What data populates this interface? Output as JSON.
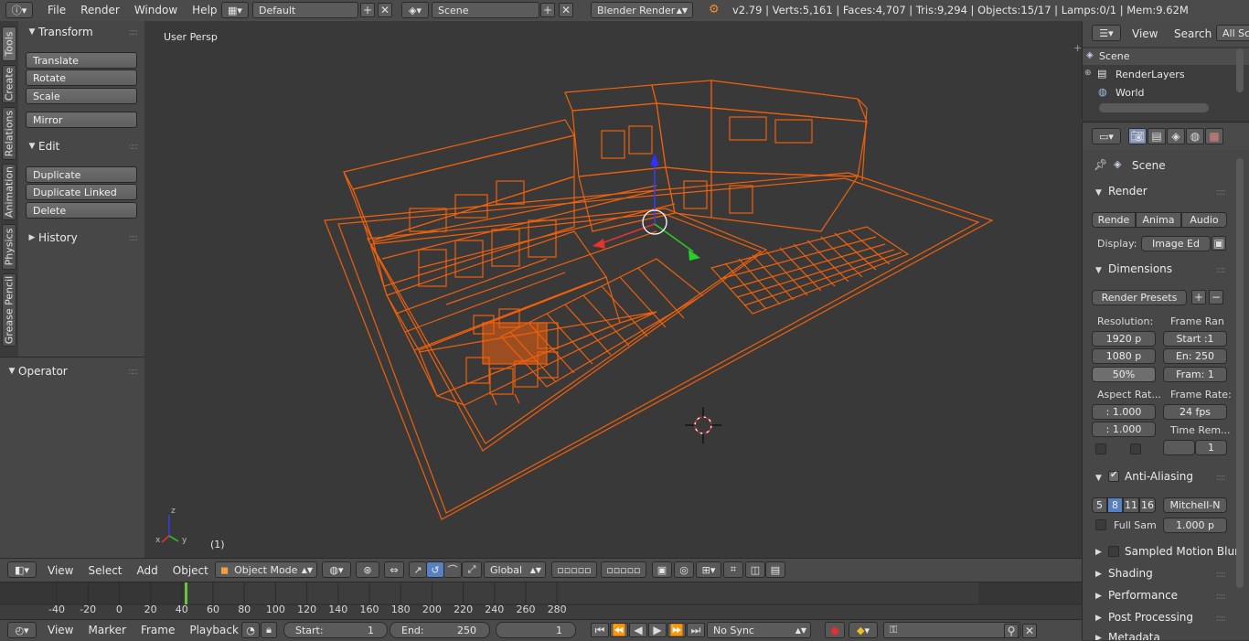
{
  "topbar": {
    "menus": [
      "File",
      "Render",
      "Window",
      "Help"
    ],
    "layout": "Default",
    "scene": "Scene",
    "engine": "Blender Render",
    "stats": "v2.79 | Verts:5,161 | Faces:4,707 | Tris:9,294 | Objects:15/17 | Lamps:0/1 | Mem:9.62M"
  },
  "tabs": [
    "Tools",
    "Create",
    "Relations",
    "Animation",
    "Physics",
    "Grease Pencil"
  ],
  "toolshelf": {
    "transform": {
      "title": "Transform",
      "buttons": [
        "Translate",
        "Rotate",
        "Scale",
        "Mirror"
      ]
    },
    "edit": {
      "title": "Edit",
      "buttons": [
        "Duplicate",
        "Duplicate Linked",
        "Delete"
      ]
    },
    "history": {
      "title": "History"
    },
    "operator": {
      "title": "Operator"
    }
  },
  "viewport": {
    "view_name": "User Persp",
    "frame_label": "(1)",
    "axis_labels": {
      "x": "x",
      "y": "y",
      "z": "z"
    }
  },
  "view3d_header": {
    "menus": [
      "View",
      "Select",
      "Add",
      "Object"
    ],
    "mode": "Object Mode",
    "orientation": "Global"
  },
  "timeline": {
    "ticks": [
      "-40",
      "-20",
      "0",
      "20",
      "40",
      "60",
      "80",
      "100",
      "120",
      "140",
      "160",
      "180",
      "200",
      "220",
      "240",
      "260",
      "280"
    ],
    "current_frame": 0
  },
  "timebar": {
    "menus": [
      "View",
      "Marker",
      "Frame",
      "Playback"
    ],
    "start_label": "Start:",
    "start_value": "1",
    "end_label": "End:",
    "end_value": "250",
    "current_value": "1",
    "sync": "No Sync"
  },
  "outliner": {
    "menus": [
      "View",
      "Search"
    ],
    "filter": "All Sc",
    "items": [
      "Scene",
      "RenderLayers",
      "World"
    ]
  },
  "properties": {
    "context": "Scene",
    "render": {
      "title": "Render",
      "buttons": [
        "Rende",
        "Anima",
        "Audio"
      ],
      "display_label": "Display:",
      "display_value": "Image Ed"
    },
    "dimensions": {
      "title": "Dimensions",
      "presets": "Render Presets",
      "resolution_label": "Resolution:",
      "res_x": "1920 p",
      "res_y": "1080 p",
      "res_pct": "50%",
      "frame_range_label": "Frame Ran",
      "start": "Start :1",
      "end": "En: 250",
      "step": "Fram: 1",
      "aspect_label": "Aspect Rat...",
      "aspect_x": ": 1.000",
      "aspect_y": ": 1.000",
      "frame_rate_label": "Frame Rate:",
      "fps": "24 fps",
      "time_remap_label": "Time Rem...",
      "time_remap_value": "1"
    },
    "antialiasing": {
      "title": "Anti-Aliasing",
      "samples": [
        "5",
        "8",
        "11",
        "16"
      ],
      "selected": "8",
      "filter": "Mitchell-N",
      "full_sample": "Full Sam",
      "size": "1.000 p"
    },
    "collapsed": [
      "Sampled Motion Blur",
      "Shading",
      "Performance",
      "Post Processing",
      "Metadata"
    ]
  },
  "colors": {
    "wire": "#f0600c",
    "viewport_bg": "#393939",
    "accent_blue": "#5680c2"
  }
}
